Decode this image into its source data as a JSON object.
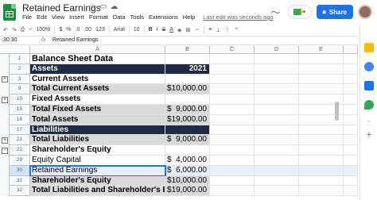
{
  "doc": {
    "title": "Retained Earnings",
    "menu": [
      "File",
      "Edit",
      "View",
      "Insert",
      "Format",
      "Data",
      "Tools",
      "Extensions",
      "Help"
    ],
    "last_edit": "Last edit was seconds ago",
    "share_label": "Share"
  },
  "toolbar": {
    "zoom": "100%",
    "currency": "$",
    "percent": "%",
    "dec_less": ".0",
    "dec_more": ".00",
    "format_more": "123",
    "font": "Arial",
    "font_size": "10",
    "bold": "B",
    "italic": "I",
    "strike": "S",
    "text_color": "A"
  },
  "formula_bar": {
    "cell_ref": ":30:30",
    "fx": "fx",
    "value": "Retained Earnings"
  },
  "columns": [
    "A",
    "B",
    "C",
    "D",
    "E"
  ],
  "rows": [
    {
      "num": "1",
      "a": "Balance Sheet Data",
      "b_sym": "",
      "b_val": "",
      "style": "title",
      "group": ""
    },
    {
      "num": "2",
      "a": "Assets",
      "b_sym": "",
      "b_val": "2021",
      "style": "dark",
      "group": ""
    },
    {
      "num": "3",
      "a": "Current Assets",
      "b_sym": "",
      "b_val": "",
      "style": "bold",
      "group": "+"
    },
    {
      "num": "9",
      "a": "Total Current Assets",
      "b_sym": "$",
      "b_val": "10,000.00",
      "style": "grey",
      "group": ""
    },
    {
      "num": "10",
      "a": "Fixed Assets",
      "b_sym": "",
      "b_val": "",
      "style": "bold",
      "group": "+"
    },
    {
      "num": "15",
      "a": "Total Fixed Assets",
      "b_sym": "$",
      "b_val": "9,000.00",
      "style": "grey",
      "group": ""
    },
    {
      "num": "16",
      "a": "Total Assets",
      "b_sym": "$",
      "b_val": "19,000.00",
      "style": "grey",
      "group": ""
    },
    {
      "num": "17",
      "a": "Liabilities",
      "b_sym": "",
      "b_val": "",
      "style": "dark",
      "group": ""
    },
    {
      "num": "21",
      "a": "Total Liabilities",
      "b_sym": "$",
      "b_val": "9,000.00",
      "style": "grey",
      "group": "+"
    },
    {
      "num": "22",
      "a": "Shareholder's Equity",
      "b_sym": "",
      "b_val": "",
      "style": "bold",
      "group": "-"
    },
    {
      "num": "29",
      "a": "Equity Capital",
      "b_sym": "$",
      "b_val": "4,000.00",
      "style": "plain",
      "group": ""
    },
    {
      "num": "30",
      "a": "Retained Earnings",
      "b_sym": "$",
      "b_val": "6,000.00",
      "style": "selected",
      "group": ""
    },
    {
      "num": "31",
      "a": "Shareholder's Equity",
      "b_sym": "$",
      "b_val": "10,000.00",
      "style": "grey",
      "group": ""
    },
    {
      "num": "32",
      "a": "Total Liabilities and Shareholder's Equity",
      "b_sym": "$",
      "b_val": "19,000.00",
      "style": "grey",
      "group": ""
    }
  ],
  "colors": {
    "header_dark": "#1f2a44",
    "total_grey": "#d9d9d9",
    "selection": "#1a73e8",
    "share": "#1a73e8",
    "logo": "#1e8e3e"
  }
}
